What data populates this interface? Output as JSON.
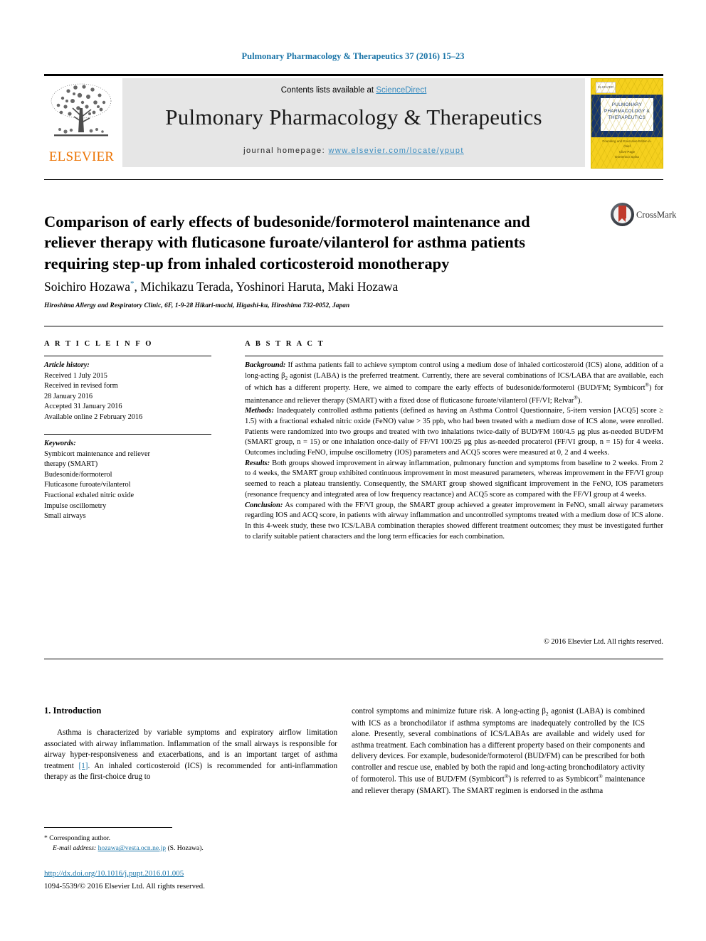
{
  "running_head": "Pulmonary Pharmacology & Therapeutics 37 (2016) 15–23",
  "masthead": {
    "contents_prefix": "Contents lists available at ",
    "contents_link": "ScienceDirect",
    "journal_title": "Pulmonary Pharmacology & Therapeutics",
    "homepage_prefix": "journal homepage: ",
    "homepage_url": "www.elsevier.com/locate/ypupt",
    "publisher": "ELSEVIER",
    "cover": {
      "title": "PULMONARY PHARMACOLOGY & THERAPEUTICS",
      "imprint": "ELSEVIER",
      "sub1": "Founding and Executive Editor-in-chief",
      "sub2": "Clive Page",
      "sub3": "Domenico Spina"
    }
  },
  "article": {
    "title": "Comparison of early effects of budesonide/formoterol maintenance and reliever therapy with fluticasone furoate/vilanterol for asthma patients requiring step-up from inhaled corticosteroid monotherapy",
    "authors": "Soichiro Hozawa, Michikazu Terada, Yoshinori Haruta, Maki Hozawa",
    "author_marker": "*",
    "affiliation": "Hiroshima Allergy and Respiratory Clinic, 6F, 1-9-28 Hikari-machi, Higashi-ku, Hiroshima 732-0052, Japan",
    "crossmark_label": "CrossMark"
  },
  "info": {
    "heading": "A R T I C L E  I N F O",
    "history_label": "Article history:",
    "history": [
      "Received 1 July 2015",
      "Received in revised form",
      "28 January 2016",
      "Accepted 31 January 2016",
      "Available online 2 February 2016"
    ],
    "keywords_label": "Keywords:",
    "keywords": [
      "Symbicort maintenance and reliever",
      "therapy (SMART)",
      "Budesonide/formoterol",
      "Fluticasone furoate/vilanterol",
      "Fractional exhaled nitric oxide",
      "Impulse oscillometry",
      "Small airways"
    ]
  },
  "abstract": {
    "heading": "A B S T R A C T",
    "background_label": "Background:",
    "background": " If asthma patients fail to achieve symptom control using a medium dose of inhaled corticosteroid (ICS) alone, addition of a long-acting β2 agonist (LABA) is the preferred treatment. Currently, there are several combinations of ICS/LABA that are available, each of which has a different property. Here, we aimed to compare the early effects of budesonide/formoterol (BUD/FM; Symbicort®) for maintenance and reliever therapy (SMART) with a fixed dose of fluticasone furoate/vilanterol (FF/VI; Relvar®).",
    "methods_label": "Methods:",
    "methods": " Inadequately controlled asthma patients (defined as having an Asthma Control Questionnaire, 5-item version [ACQ5] score ≥ 1.5) with a fractional exhaled nitric oxide (FeNO) value > 35 ppb, who had been treated with a medium dose of ICS alone, were enrolled. Patients were randomized into two groups and treated with two inhalations twice-daily of BUD/FM 160/4.5 μg plus as-needed BUD/FM (SMART group, n = 15) or one inhalation once-daily of FF/VI 100/25 μg plus as-needed procaterol (FF/VI group, n = 15) for 4 weeks. Outcomes including FeNO, impulse oscillometry (IOS) parameters and ACQ5 scores were measured at 0, 2 and 4 weeks.",
    "results_label": "Results:",
    "results": " Both groups showed improvement in airway inflammation, pulmonary function and symptoms from baseline to 2 weeks. From 2 to 4 weeks, the SMART group exhibited continuous improvement in most measured parameters, whereas improvement in the FF/VI group seemed to reach a plateau transiently. Consequently, the SMART group showed significant improvement in the FeNO, IOS parameters (resonance frequency and integrated area of low frequency reactance) and ACQ5 score as compared with the FF/VI group at 4 weeks.",
    "conclusion_label": "Conclusion:",
    "conclusion": " As compared with the FF/VI group, the SMART group achieved a greater improvement in FeNO, small airway parameters regarding IOS and ACQ score, in patients with airway inflammation and uncontrolled symptoms treated with a medium dose of ICS alone. In this 4-week study, these two ICS/LABA combination therapies showed different treatment outcomes; they must be investigated further to clarify suitable patient characters and the long term efficacies for each combination.",
    "copyright": "© 2016 Elsevier Ltd. All rights reserved."
  },
  "body": {
    "section_number": "1.",
    "section_title": "Introduction",
    "paragraph_left_part1": "Asthma is characterized by variable symptoms and expiratory airflow limitation associated with airway inflammation. Inflammation of the small airways is responsible for airway hyper-responsiveness and exacerbations, and is an important target of asthma treatment ",
    "reference_marker": "[1]",
    "paragraph_left_part2": ". An inhaled corticosteroid (ICS) is recommended for anti-inflammation therapy as the first-choice drug to",
    "paragraph_right": "control symptoms and minimize future risk. A long-acting β2 agonist (LABA) is combined with ICS as a bronchodilator if asthma symptoms are inadequately controlled by the ICS alone. Presently, several combinations of ICS/LABAs are available and widely used for asthma treatment. Each combination has a different property based on their components and delivery devices. For example, budesonide/formoterol (BUD/FM) can be prescribed for both controller and rescue use, enabled by both the rapid and long-acting bronchodilatory activity of formoterol. This use of BUD/FM (Symbicort®) is referred to as Symbicort® maintenance and reliever therapy (SMART). The SMART regimen is endorsed in the asthma"
  },
  "footer": {
    "corresponding_marker": "*",
    "corresponding_label": "Corresponding author.",
    "email_label": "E-mail address:",
    "email": "hozawa@vesta.ocn.ne.jp",
    "email_owner": "(S. Hozawa).",
    "doi": "http://dx.doi.org/10.1016/j.pupt.2016.01.005",
    "issn_line": "1094-5539/© 2016 Elsevier Ltd. All rights reserved."
  },
  "colors": {
    "link": "#1b75a8",
    "elsevier_orange": "#ec7404",
    "cover_yellow": "#f5d01e",
    "cover_blue": "#16356b"
  }
}
